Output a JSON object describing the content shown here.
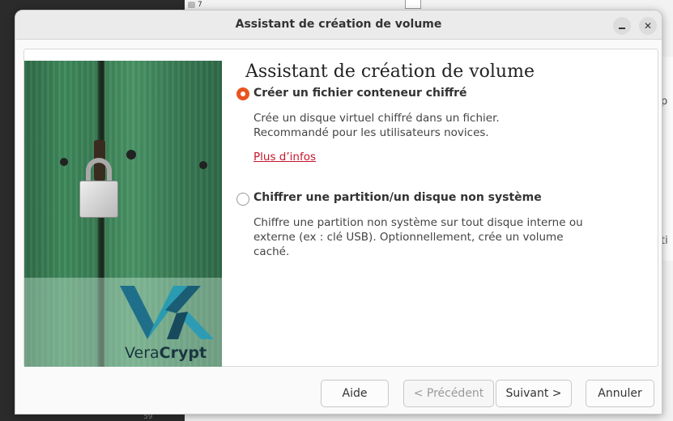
{
  "background": {
    "tab_number": "7",
    "right_text_1": "p",
    "right_text_2": "ti",
    "bottom_number": "59"
  },
  "dialog": {
    "title": "Assistant de création de volume",
    "heading": "Assistant de création de volume",
    "brand": {
      "vera": "Vera",
      "crypt": "Crypt"
    },
    "options": [
      {
        "label": "Créer un fichier conteneur chiffré",
        "description": "Crée un disque virtuel chiffré dans un fichier. Recommandé pour les utilisateurs novices.",
        "link": "Plus d’infos",
        "selected": true
      },
      {
        "label": "Chiffrer une partition/un disque non système",
        "description": "Chiffre une partition non système sur tout disque interne ou externe (ex : clé USB). Optionnellement, crée un volume caché.",
        "selected": false
      }
    ],
    "buttons": {
      "help": "Aide",
      "previous": "< Précédent",
      "next": "Suivant >",
      "cancel": "Annuler"
    },
    "window_controls": {
      "close_glyph": "✕"
    }
  },
  "colors": {
    "accent": "#e95420",
    "link": "#c7162b"
  }
}
